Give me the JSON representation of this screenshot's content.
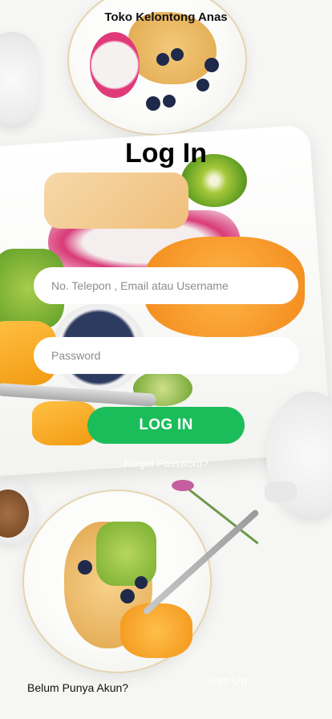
{
  "header": {
    "shop_name": "Toko Kelontong Anas"
  },
  "login": {
    "title": "Log In",
    "username_placeholder": "No. Telepon , Email atau Username",
    "password_placeholder": "Password",
    "submit_label": "LOG IN",
    "forgot_label": "Forgot Password?"
  },
  "footer": {
    "no_account_label": "Belum Punya Akun?",
    "signup_label": "Sign Up"
  },
  "colors": {
    "accent_green": "#1bbd5b",
    "field_background": "#ffffff"
  }
}
